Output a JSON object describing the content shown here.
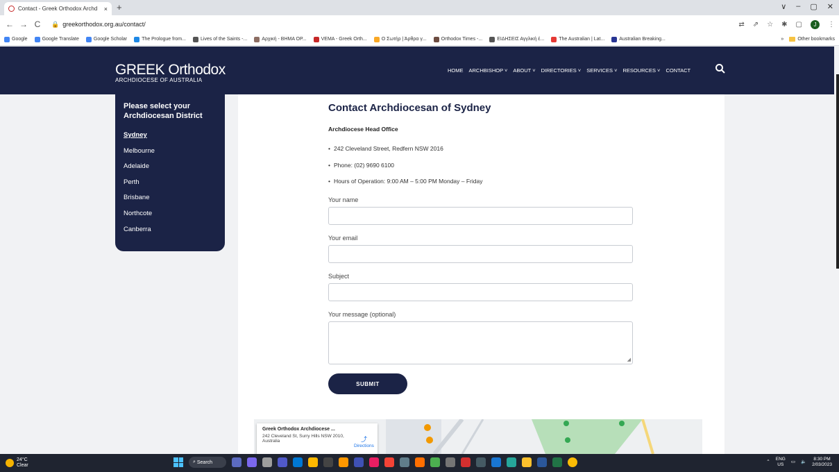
{
  "browser": {
    "tab_title": "Contact - Greek Orthodox Archd",
    "tab_close": "×",
    "new_tab": "+",
    "url": "greekorthodox.org.au/contact/",
    "window_controls": [
      "∨",
      "–",
      "▢",
      "✕"
    ],
    "profile_initial": "J"
  },
  "bookmarks": {
    "items": [
      {
        "label": "Google",
        "color": "#4285f4"
      },
      {
        "label": "Google Translate",
        "color": "#4285f4"
      },
      {
        "label": "Google Scholar",
        "color": "#4285f4"
      },
      {
        "label": "The Prologue from...",
        "color": "#1e88e5"
      },
      {
        "label": "Lives of the Saints -...",
        "color": "#555555"
      },
      {
        "label": "Αρχική - ΒΗΜΑ ΟΡ...",
        "color": "#8d6e63"
      },
      {
        "label": "VEMA - Greek Orth...",
        "color": "#c62828"
      },
      {
        "label": "Ο Σωτήρ | Άρθρα γ...",
        "color": "#f9a825"
      },
      {
        "label": "Orthodox Times -...",
        "color": "#6d4c41"
      },
      {
        "label": "ΕΙΔΗΣΕΙΣ Αγγλική έ...",
        "color": "#555555"
      },
      {
        "label": "The Australian | Lat...",
        "color": "#e53935"
      },
      {
        "label": "Australian Breaking...",
        "color": "#283593"
      }
    ],
    "more": "»",
    "other": "Other bookmarks"
  },
  "site": {
    "logo_line1": "GREEK Orthodox",
    "logo_line2": "ARCHDIOCESE OF AUSTRALIA",
    "menu": [
      "HOME",
      "ARCHBISHOP ˅",
      "ABOUT ˅",
      "DIRECTORIES ˅",
      "SERVICES ˅",
      "RESOURCES ˅",
      "CONTACT"
    ]
  },
  "sidebar": {
    "title": "Please select your Archdiocesan District",
    "items": [
      "Sydney",
      "Melbourne",
      "Adelaide",
      "Perth",
      "Brisbane",
      "Northcote",
      "Canberra"
    ]
  },
  "contact": {
    "heading": "Contact Archdiocesan of Sydney",
    "subheading": "Archdiocese Head Office",
    "address": "242 Cleveland Street, Redfern NSW 2016",
    "phone": "Phone: (02) 9690 6100",
    "hours": "Hours of Operation: 9:00 AM – 5:00 PM Monday – Friday"
  },
  "form": {
    "name_label": "Your name",
    "email_label": "Your email",
    "subject_label": "Subject",
    "message_label": "Your message (optional)",
    "submit": "SUBMIT"
  },
  "map": {
    "place_name": "Greek Orthodox Archdiocese ...",
    "place_address": "242 Cleveland St, Surry Hills NSW 2010, Australia",
    "directions": "Directions"
  },
  "taskbar": {
    "temperature": "24°C",
    "condition": "Clear",
    "search": "Search",
    "language": "ENG",
    "region": "US",
    "time": "8:30 PM",
    "date": "2/03/2023"
  }
}
